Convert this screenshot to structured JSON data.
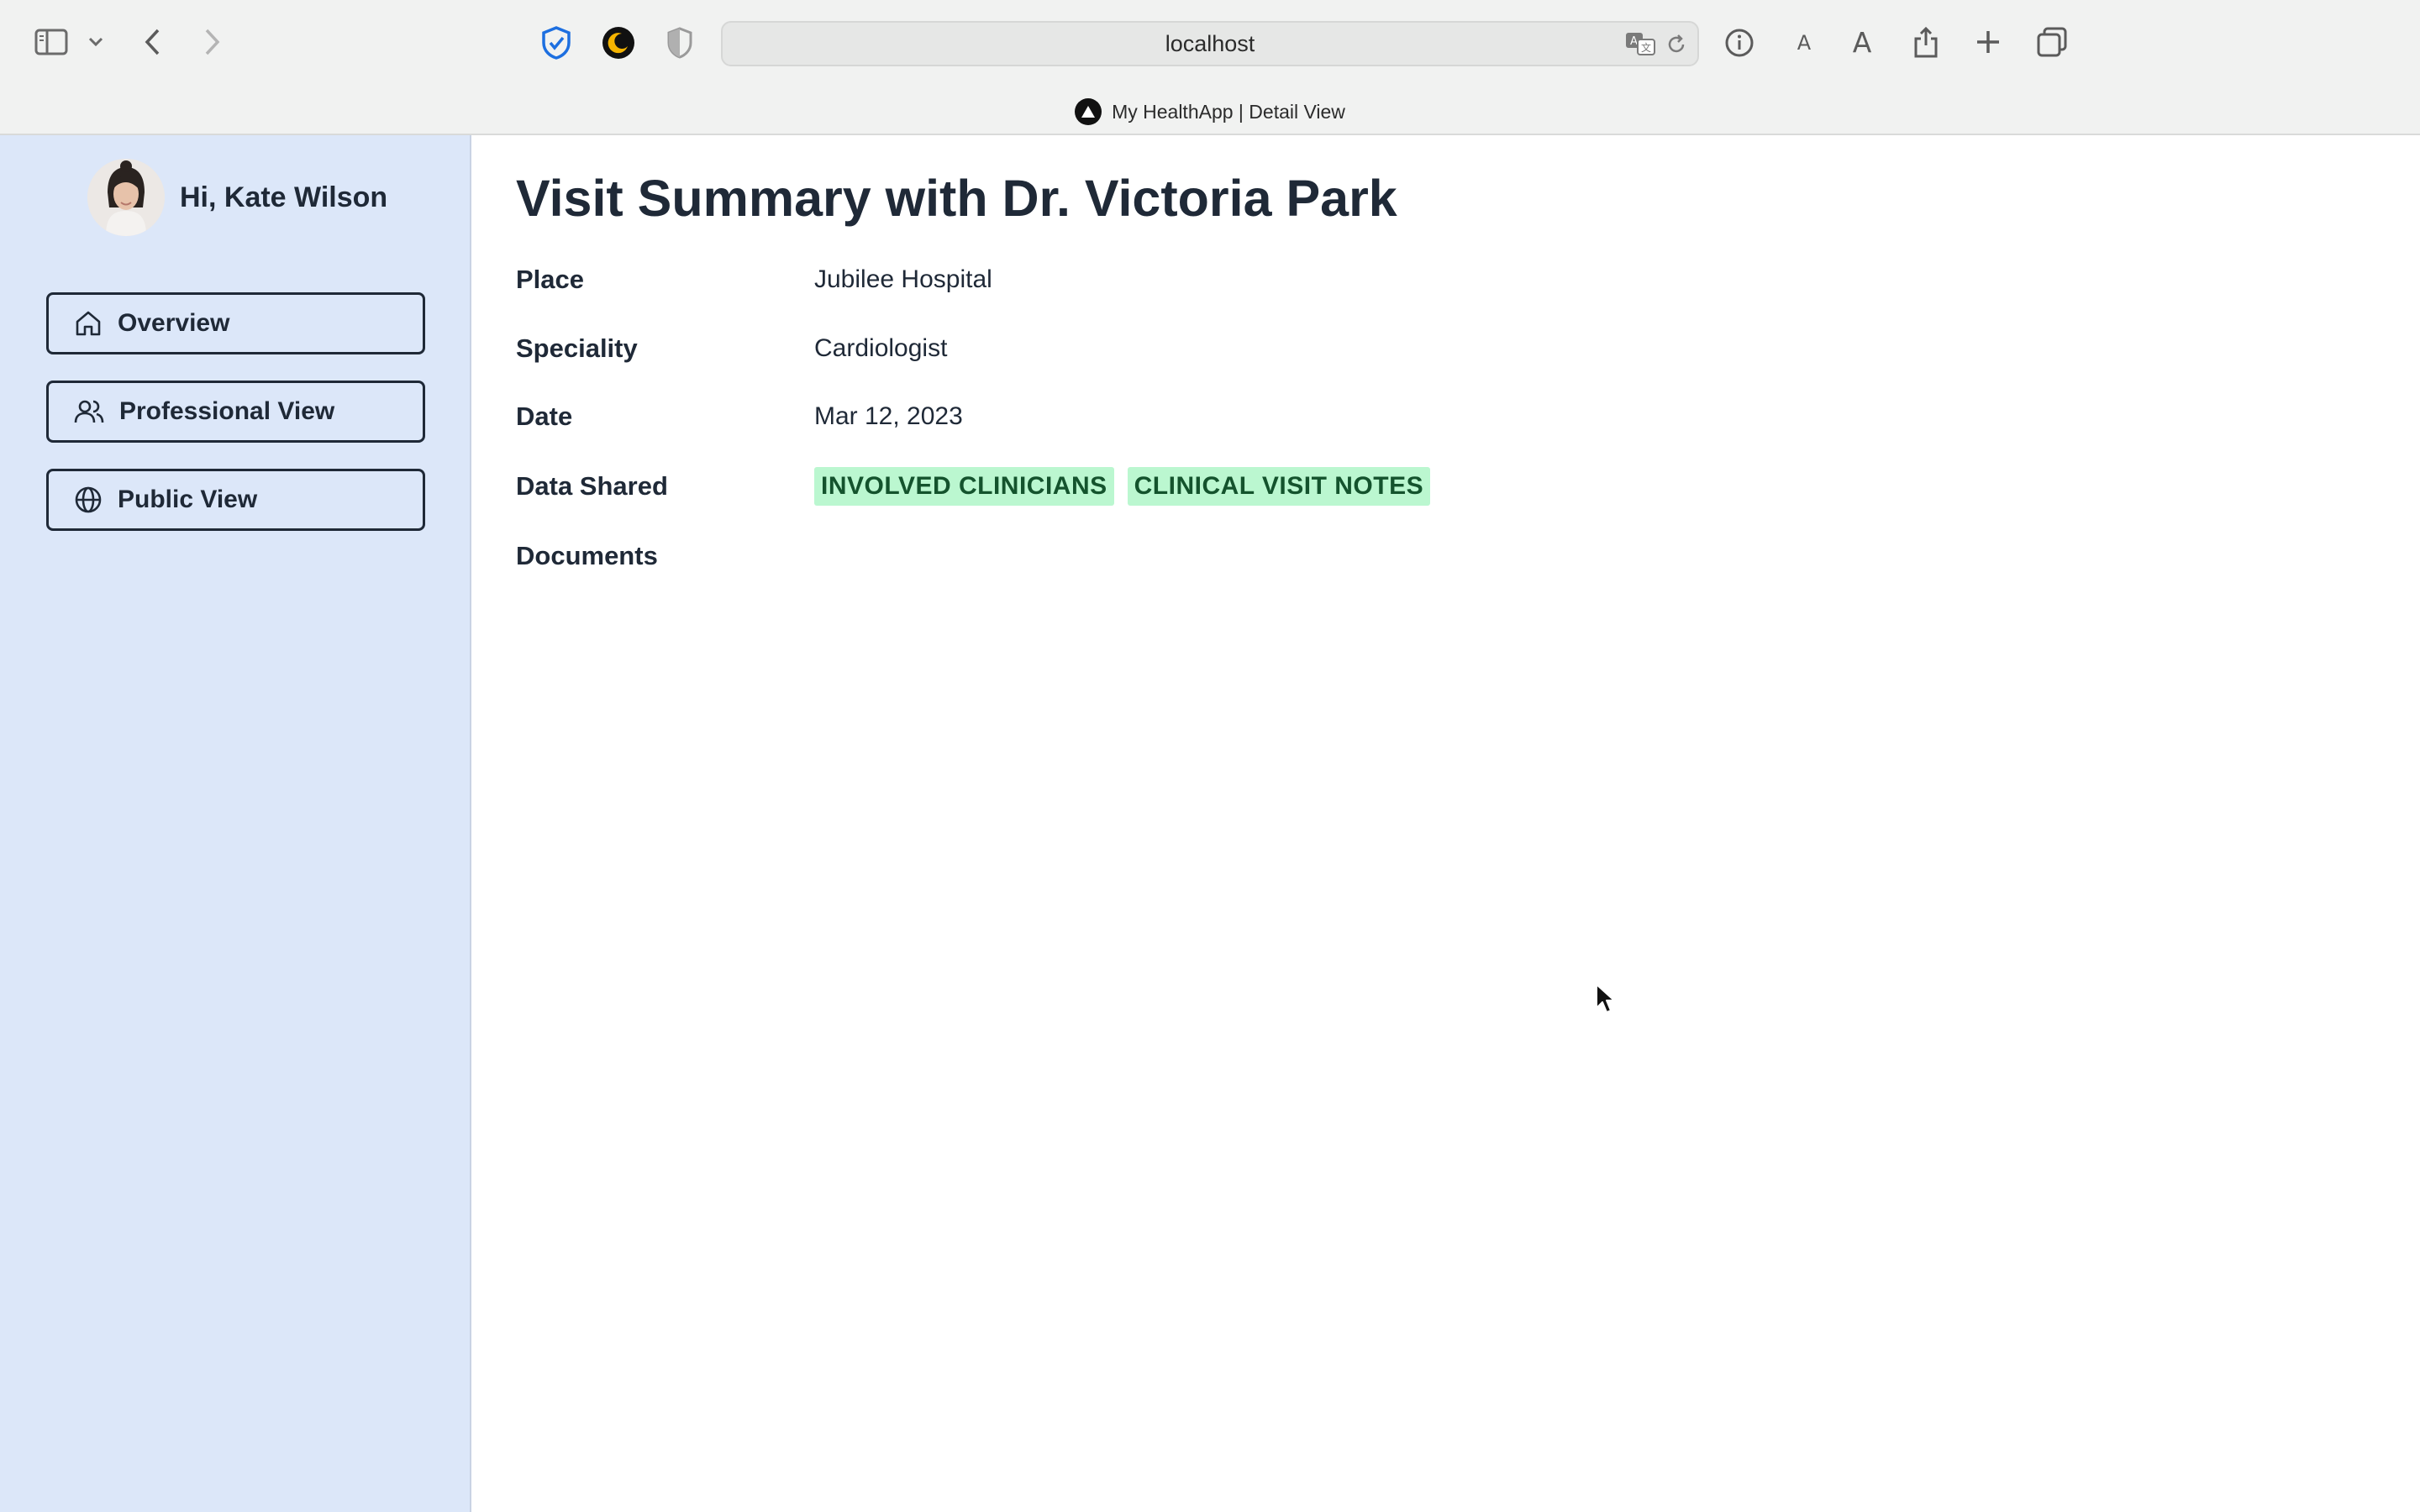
{
  "browser": {
    "url": "localhost",
    "tab_title": "My HealthApp | Detail View"
  },
  "sidebar": {
    "greeting": "Hi, Kate Wilson",
    "items": [
      {
        "label": "Overview",
        "icon": "home-icon"
      },
      {
        "label": "Professional View",
        "icon": "users-icon"
      },
      {
        "label": "Public View",
        "icon": "globe-icon"
      }
    ]
  },
  "main": {
    "title": "Visit Summary with Dr. Victoria Park",
    "fields": {
      "place_label": "Place",
      "place_value": "Jubilee Hospital",
      "speciality_label": "Speciality",
      "speciality_value": "Cardiologist",
      "date_label": "Date",
      "date_value": "Mar 12, 2023",
      "data_shared_label": "Data Shared",
      "data_shared_tags": [
        "INVOLVED CLINICIANS",
        "CLINICAL VISIT NOTES"
      ],
      "documents_label": "Documents"
    }
  },
  "colors": {
    "sidebar_bg": "#dce7f9",
    "tag_bg": "#bbf7d0",
    "tag_text": "#14532d",
    "text": "#1f2937"
  }
}
